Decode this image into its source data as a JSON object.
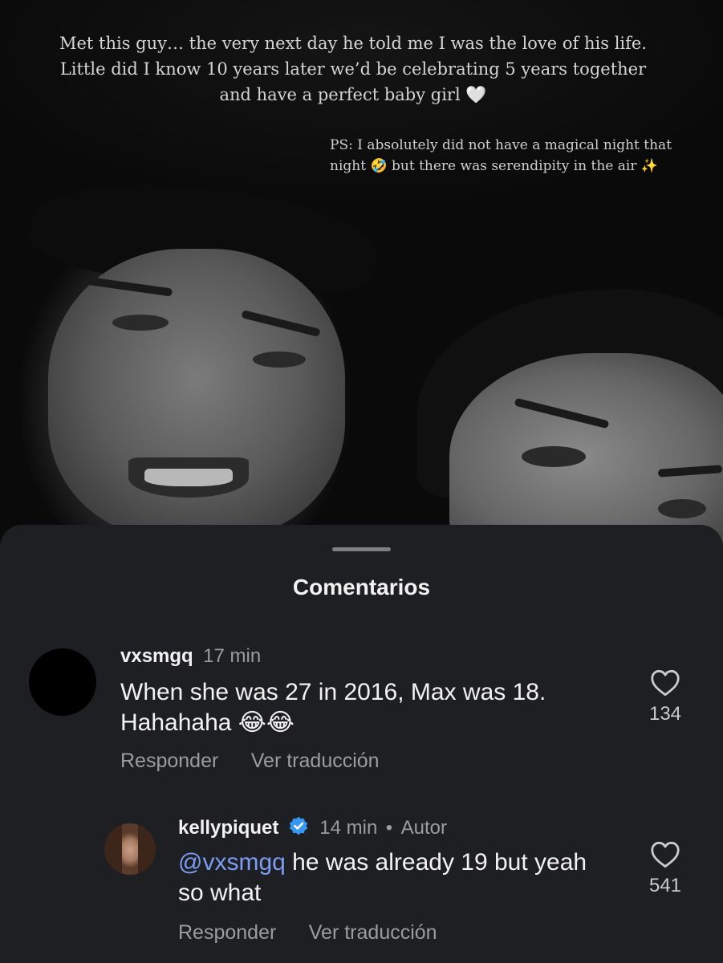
{
  "story": {
    "caption_lines": [
      "Met this guy… the very next day he told me I was the love of his life.",
      "Little did I know 10 years later we’d be celebrating 5 years together",
      "and have a perfect baby girl 🤍"
    ],
    "ps_lines": [
      "PS: I absolutely did not have a magical night that",
      "night 🤣 but there was serendipity in the air ✨"
    ]
  },
  "sheet": {
    "title": "Comentarios"
  },
  "comments": [
    {
      "username": "vxsmgq",
      "time": "17 min",
      "text": "When she was 27 in 2016, Max was 18. Hahahaha 😂😂",
      "likes": "134",
      "reply_label": "Responder",
      "translate_label": "Ver traducción"
    },
    {
      "username": "kellypiquet",
      "time": "14 min",
      "separator": "•",
      "author_tag": "Autor",
      "mention": "@vxsmgq",
      "text": " he was already 19 but yeah so what",
      "likes": "541",
      "reply_label": "Responder",
      "translate_label": "Ver traducción"
    }
  ],
  "colors": {
    "sheet_bg": "#1e1f22",
    "mention": "#7b9cf2",
    "verified_badge": "#3897f0",
    "muted_text": "#9a9ca1"
  },
  "icons": [
    "heart-outline-icon",
    "verified-badge-icon"
  ]
}
